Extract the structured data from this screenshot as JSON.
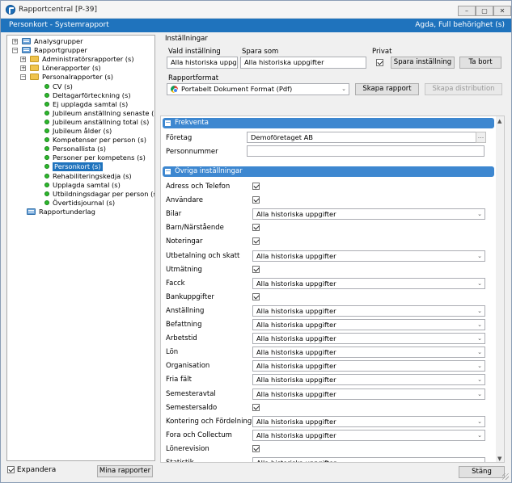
{
  "window": {
    "title": "Rapportcentral [P-39]",
    "min_glyph": "–",
    "max_glyph": "▢",
    "close_glyph": "✕"
  },
  "header": {
    "left": "Personkort - Systemrapport",
    "right": "Agda, Full behörighet (s)"
  },
  "tree": {
    "items": [
      {
        "label": "Analysgrupper",
        "icon": "book",
        "expander": "+"
      },
      {
        "label": "Rapportgrupper",
        "icon": "book",
        "expander": "−"
      },
      {
        "label": "Administratörsrapporter (s)",
        "icon": "folder",
        "expander": "+"
      },
      {
        "label": "Lönerapporter (s)",
        "icon": "folder",
        "expander": "+"
      },
      {
        "label": "Personalrapporter (s)",
        "icon": "folder",
        "expander": "−"
      },
      {
        "label": "CV (s)",
        "icon": "bullet"
      },
      {
        "label": "Deltagarförteckning (s)",
        "icon": "bullet"
      },
      {
        "label": "Ej upplagda samtal (s)",
        "icon": "bullet"
      },
      {
        "label": "Jubileum anställning senaste (s)",
        "icon": "bullet"
      },
      {
        "label": "Jubileum anställning total (s)",
        "icon": "bullet"
      },
      {
        "label": "Jubileum ålder (s)",
        "icon": "bullet"
      },
      {
        "label": "Kompetenser per person (s)",
        "icon": "bullet"
      },
      {
        "label": "Personallista (s)",
        "icon": "bullet"
      },
      {
        "label": "Personer per kompetens (s)",
        "icon": "bullet"
      },
      {
        "label": "Personkort (s)",
        "icon": "bullet",
        "selected": true
      },
      {
        "label": "Rehabiliteringskedja (s)",
        "icon": "bullet"
      },
      {
        "label": "Upplagda samtal (s)",
        "icon": "bullet"
      },
      {
        "label": "Utbildningsdagar per person (s)",
        "icon": "bullet"
      },
      {
        "label": "Övertidsjournal (s)",
        "icon": "bullet"
      },
      {
        "label": "Rapportunderlag",
        "icon": "book"
      }
    ]
  },
  "bottom_left": {
    "expandera_label": "Expandera",
    "expandera_checked": true,
    "mina_rapporter": "Mina rapporter"
  },
  "settings": {
    "group_title": "Inställningar",
    "vald_label": "Vald inställning",
    "vald_value": "Alla historiska uppgif",
    "spara_som_label": "Spara som",
    "spara_som_value": "Alla historiska uppgifter",
    "privat_label": "Privat",
    "privat_checked": true,
    "spara_btn": "Spara inställning",
    "ta_bort_btn": "Ta bort",
    "format_label": "Rapportformat",
    "format_value": "Portabelt Dokument Format (Pdf)",
    "skapa_btn": "Skapa rapport",
    "distribution_btn": "Skapa distribution"
  },
  "frekventa": {
    "title": "Frekventa",
    "collapse_glyph": "−",
    "foretag_label": "Företag",
    "foretag_value": "Demoföretaget AB",
    "personnummer_label": "Personnummer",
    "personnummer_value": ""
  },
  "ovriga": {
    "title": "Övriga inställningar",
    "collapse_glyph": "−",
    "rows": [
      {
        "label": "Adress och Telefon",
        "type": "check",
        "checked": true
      },
      {
        "label": "Användare",
        "type": "check",
        "checked": true
      },
      {
        "label": "Bilar",
        "type": "select",
        "value": "Alla historiska uppgifter"
      },
      {
        "label": "Barn/Närstående",
        "type": "check",
        "checked": true
      },
      {
        "label": "Noteringar",
        "type": "check",
        "checked": true
      },
      {
        "label": "Utbetalning och skatt",
        "type": "select",
        "value": "Alla historiska uppgifter"
      },
      {
        "label": "Utmätning",
        "type": "check",
        "checked": true
      },
      {
        "label": "Facck",
        "type": "select",
        "value": "Alla historiska uppgifter"
      },
      {
        "label": "Bankuppgifter",
        "type": "check",
        "checked": true
      },
      {
        "label": "Anställning",
        "type": "select",
        "value": "Alla historiska uppgifter"
      },
      {
        "label": "Befattning",
        "type": "select",
        "value": "Alla historiska uppgifter"
      },
      {
        "label": "Arbetstid",
        "type": "select",
        "value": "Alla historiska uppgifter"
      },
      {
        "label": "Lön",
        "type": "select",
        "value": "Alla historiska uppgifter"
      },
      {
        "label": "Organisation",
        "type": "select",
        "value": "Alla historiska uppgifter"
      },
      {
        "label": "Fria fält",
        "type": "select",
        "value": "Alla historiska uppgifter"
      },
      {
        "label": "Semesteravtal",
        "type": "select",
        "value": "Alla historiska uppgifter"
      },
      {
        "label": "Semestersaldo",
        "type": "check",
        "checked": true
      },
      {
        "label": "Kontering och Fördelning",
        "type": "select",
        "value": "Alla historiska uppgifter"
      },
      {
        "label": "Fora och Collectum",
        "type": "select",
        "value": "Alla historiska uppgifter"
      },
      {
        "label": "Lönerevision",
        "type": "check",
        "checked": true
      },
      {
        "label": "Statistik",
        "type": "select",
        "value": "Alla historiska uppgifter"
      }
    ]
  },
  "footer": {
    "stang": "Stäng"
  },
  "icons": {
    "dropdown": "⌄",
    "ellipsis": "...",
    "scroll_up": "▲",
    "scroll_down": "▼"
  },
  "colors": {
    "accent": "#1f73bd",
    "section": "#3d87d0",
    "bullet": "#2db82d",
    "folder": "#f0c44c"
  }
}
